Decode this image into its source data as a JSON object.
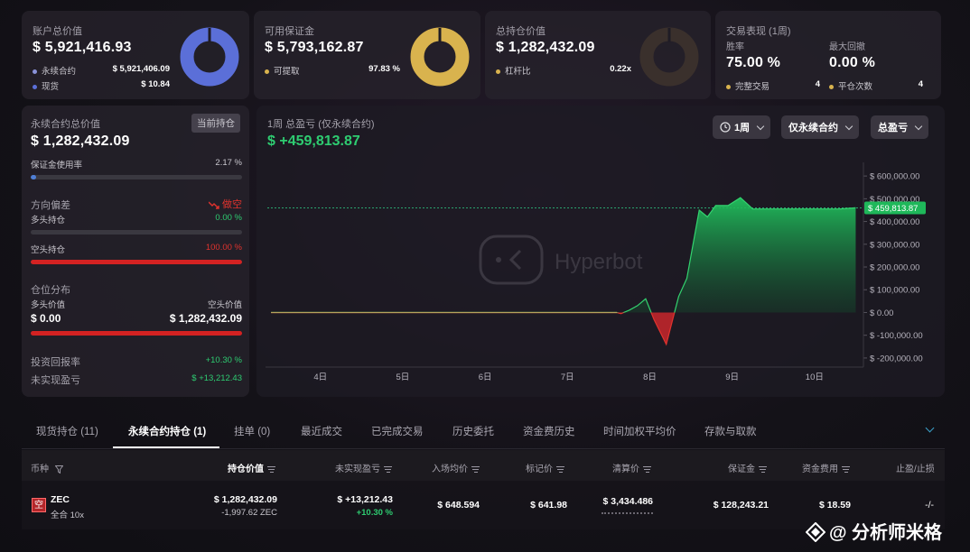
{
  "summary": {
    "account": {
      "title": "账户总价值",
      "value": "$ 5,921,416.93",
      "items": [
        {
          "label": "永续合约",
          "value": "$ 5,921,406.09"
        },
        {
          "label": "现货",
          "value": "$ 10.84"
        }
      ],
      "donut_color": "#5b6fd8"
    },
    "margin": {
      "title": "可用保证金",
      "value": "$ 5,793,162.87",
      "items": [
        {
          "label": "可提取",
          "value": "97.83 %"
        }
      ],
      "donut_color": "#d9b34e"
    },
    "holdings": {
      "title": "总持仓价值",
      "value": "$ 1,282,432.09",
      "items": [
        {
          "label": "杠杆比",
          "value": "0.22x"
        }
      ],
      "donut_color": "#3a302c"
    },
    "performance": {
      "title": "交易表现 (1周)",
      "win_rate_label": "胜率",
      "win_rate": "75.00 %",
      "drawdown_label": "最大回撤",
      "drawdown": "0.00 %",
      "completed_label": "完整交易",
      "completed": "4",
      "closes_label": "平仓次数",
      "closes": "4"
    }
  },
  "perp": {
    "title": "永续合约总价值",
    "badge": "当前持仓",
    "value": "$ 1,282,432.09",
    "margin_usage_label": "保证金使用率",
    "margin_usage": "2.17 %",
    "margin_usage_pct": 2.17,
    "direction_label": "方向偏差",
    "direction_value": "做空",
    "long_label": "多头持仓",
    "long_pct_text": "0.00 %",
    "long_pct": 0,
    "short_label": "空头持仓",
    "short_pct_text": "100.00 %",
    "short_pct": 100,
    "dist_label": "仓位分布",
    "long_value_label": "多头价值",
    "long_value": "$ 0.00",
    "short_value_label": "空头价值",
    "short_value": "$ 1,282,432.09",
    "roi_label": "投资回报率",
    "roi": "+10.30 %",
    "upnl_label": "未实现盈亏",
    "upnl": "$ +13,212.43"
  },
  "chart_panel": {
    "title": "1周 总盈亏 (仅永续合约)",
    "value": "$ +459,813.87",
    "period_btn": "1周",
    "filter_btn": "仅永续合约",
    "metric_btn": "总盈亏",
    "watermark": "Hyperbot",
    "current_label": "$ 459,813.87"
  },
  "chart_data": {
    "type": "area",
    "title": "1周 总盈亏 (仅永续合约)",
    "x_ticks": [
      "4日",
      "5日",
      "6日",
      "7日",
      "8日",
      "9日",
      "10日"
    ],
    "y_ticks": [
      "$ 600,000.00",
      "$ 500,000.00",
      "$ 400,000.00",
      "$ 300,000.00",
      "$ 200,000.00",
      "$ 100,000.00",
      "$ 0.00",
      "$ -100,000.00",
      "$ -200,000.00"
    ],
    "y_tick_values": [
      600000,
      500000,
      400000,
      300000,
      200000,
      100000,
      0,
      -100000,
      -200000
    ],
    "ylim": [
      -240000,
      660000
    ],
    "x_range_days": [
      3.4,
      10.55
    ],
    "current_value": 459813.87,
    "points": [
      [
        3.4,
        0
      ],
      [
        4.0,
        0
      ],
      [
        5.0,
        0
      ],
      [
        6.0,
        0
      ],
      [
        7.0,
        0
      ],
      [
        7.6,
        0
      ],
      [
        7.65,
        -5000
      ],
      [
        7.75,
        10000
      ],
      [
        7.85,
        30000
      ],
      [
        7.95,
        60000
      ],
      [
        8.05,
        -30000
      ],
      [
        8.2,
        -140000
      ],
      [
        8.35,
        70000
      ],
      [
        8.45,
        150000
      ],
      [
        8.6,
        450000
      ],
      [
        8.7,
        420000
      ],
      [
        8.8,
        470000
      ],
      [
        8.95,
        470000
      ],
      [
        9.1,
        505000
      ],
      [
        9.25,
        455000
      ],
      [
        9.5,
        455000
      ],
      [
        10.0,
        455000
      ],
      [
        10.3,
        455000
      ],
      [
        10.5,
        460000
      ]
    ],
    "positive_color": "#20c05c",
    "negative_color": "#e0332e"
  },
  "tabs": [
    {
      "label": "现货持仓 (11)",
      "active": false
    },
    {
      "label": "永续合约持仓 (1)",
      "active": true
    },
    {
      "label": "挂单 (0)",
      "active": false
    },
    {
      "label": "最近成交",
      "active": false
    },
    {
      "label": "已完成交易",
      "active": false
    },
    {
      "label": "历史委托",
      "active": false
    },
    {
      "label": "资金费历史",
      "active": false
    },
    {
      "label": "时间加权平均价",
      "active": false
    },
    {
      "label": "存款与取款",
      "active": false
    }
  ],
  "table": {
    "headers": {
      "coin": "币种",
      "value": "持仓价值",
      "upnl": "未实现盈亏",
      "entry": "入场均价",
      "mark": "标记价",
      "liq": "清算价",
      "margin": "保证金",
      "funding": "资金费用",
      "tpsl": "止盈/止损"
    },
    "row": {
      "badge": "空",
      "coin": "ZEC",
      "mode": "全合 10x",
      "value": "$ 1,282,432.09",
      "size": "-1,997.62 ZEC",
      "upnl": "$ +13,212.43",
      "upnl_pct": "+10.30 %",
      "entry": "$ 648.594",
      "mark": "$ 641.98",
      "liq": "$ 3,434.486",
      "margin": "$ 128,243.21",
      "funding": "$ 18.59",
      "tpsl": "-/-"
    }
  },
  "watermark_text": "@ 分析师米格"
}
